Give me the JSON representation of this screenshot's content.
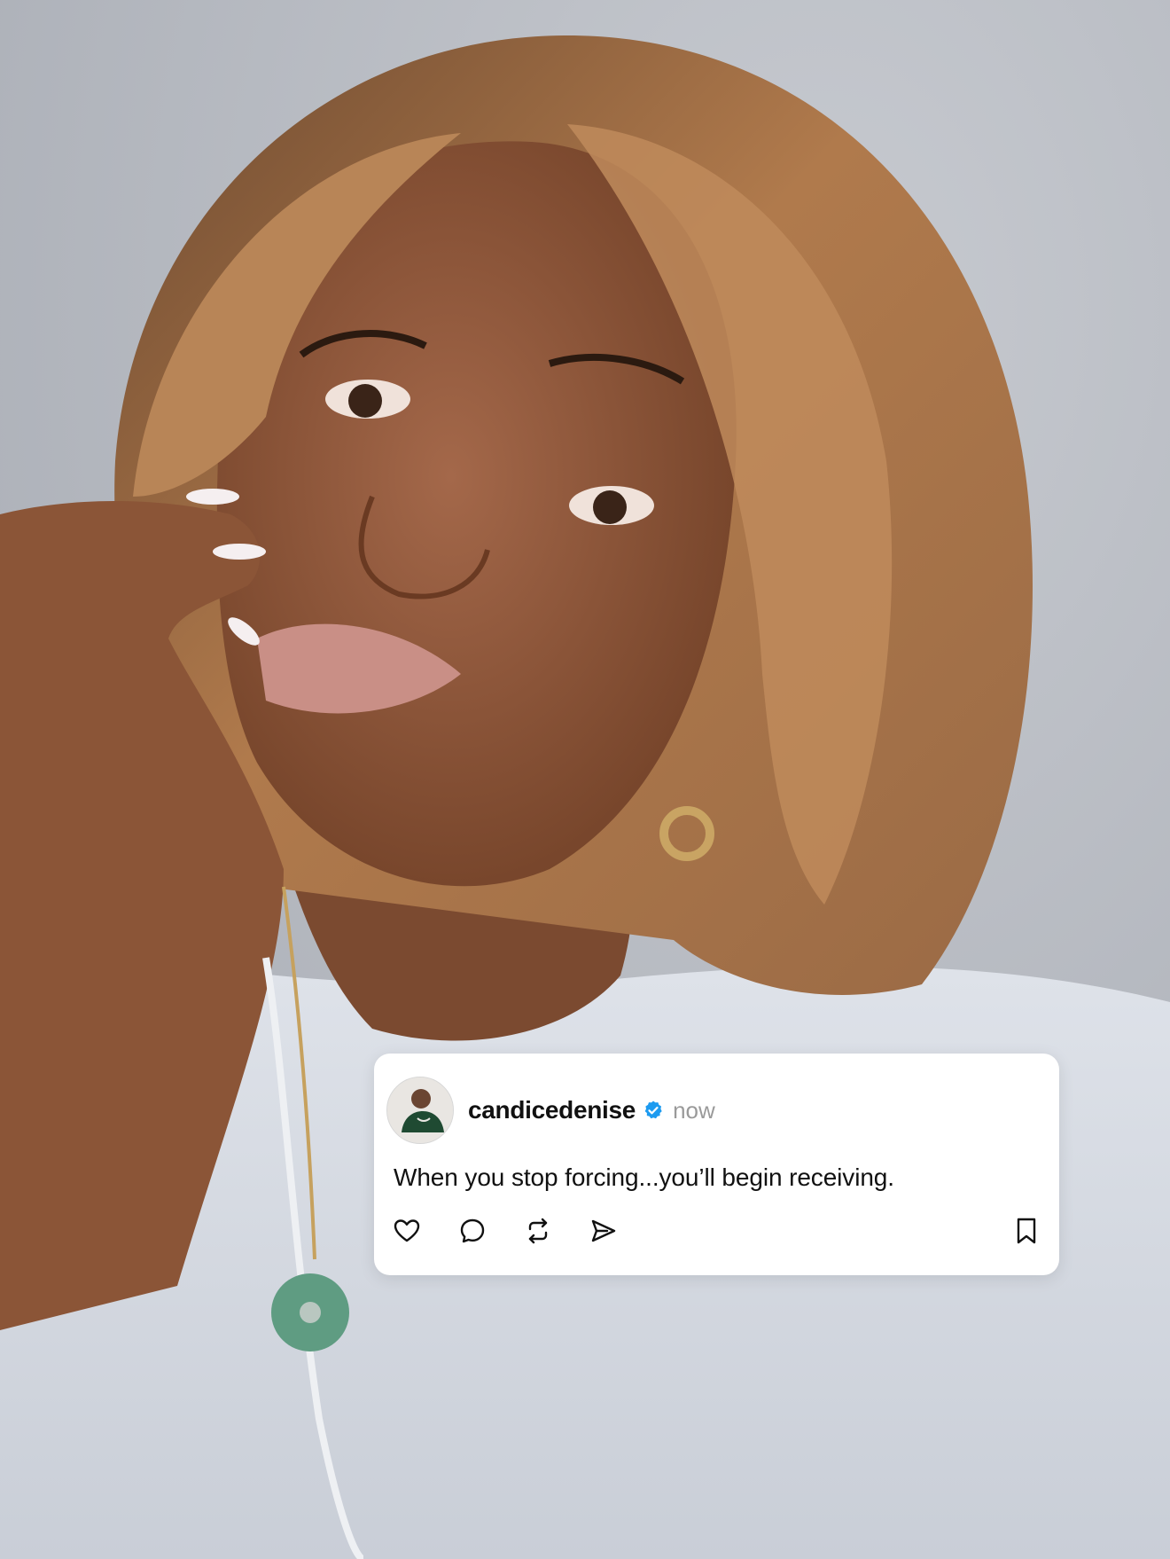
{
  "post": {
    "username": "candicedenise",
    "timestamp": "now",
    "text": "When you stop forcing...you’ll begin receiving.",
    "verified": true,
    "avatar_icon": "profile-photo",
    "actions": [
      "heart-icon",
      "comment-icon",
      "repost-icon",
      "share-icon"
    ],
    "save_icon": "bookmark-icon"
  },
  "colors": {
    "card_bg": "#ffffff",
    "username": "#111111",
    "timestamp": "#9a9a9a",
    "verified_badge": "#1d9bf0",
    "background_wall": "#b9bcc3",
    "hair": "#a87248",
    "skin": "#8a5436",
    "shirt": "#d6dbe3",
    "jade_pendant": "#5f9c82"
  }
}
